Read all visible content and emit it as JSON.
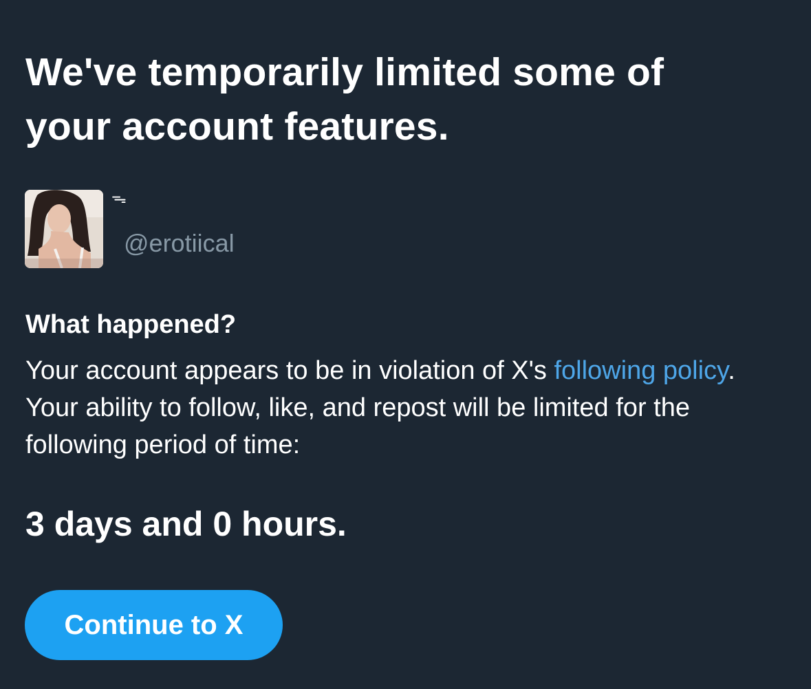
{
  "notice": {
    "headline": "We've temporarily limited some of your account features."
  },
  "account": {
    "display_name": "ᯓ",
    "handle": "@erotiical"
  },
  "details": {
    "heading": "What happened?",
    "body_prefix": "Your account appears to be in violation of X's ",
    "policy_link": "following policy",
    "body_suffix": ". Your ability to follow, like, and repost will be limited for the following period of time:"
  },
  "restriction": {
    "duration": "3 days and 0 hours."
  },
  "actions": {
    "continue_label": "Continue to X"
  },
  "colors": {
    "background": "#1c2733",
    "link": "#4ea6e8",
    "muted": "#8899a6",
    "button": "#1da1f2"
  }
}
